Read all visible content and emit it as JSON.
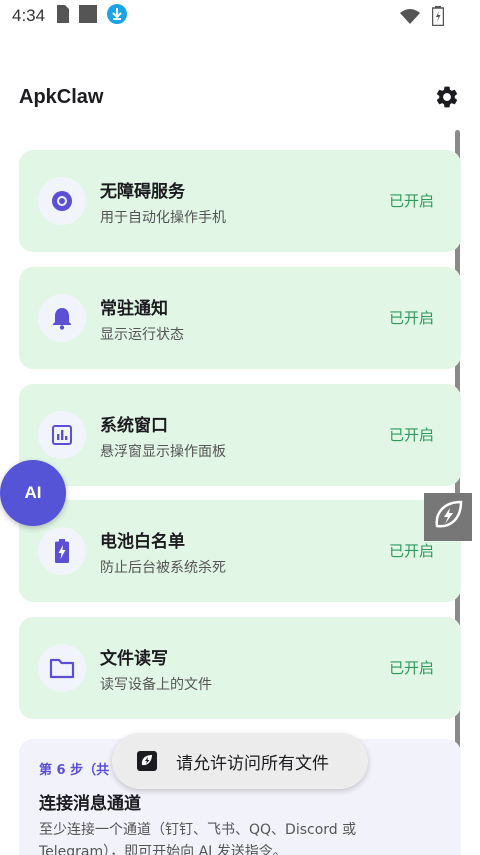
{
  "status_bar": {
    "time": "4:34",
    "icons": [
      "sim-card-icon",
      "square-icon",
      "download-icon",
      "wifi-icon",
      "battery-icon"
    ]
  },
  "app": {
    "title": "ApkClaw",
    "settings_icon": "gear-icon"
  },
  "permissions": [
    {
      "title": "无障碍服务",
      "subtitle": "用于自动化操作手机",
      "status": "已开启",
      "icon": "accessibility-icon"
    },
    {
      "title": "常驻通知",
      "subtitle": "显示运行状态",
      "status": "已开启",
      "icon": "bell-icon"
    },
    {
      "title": "系统窗口",
      "subtitle": "悬浮窗显示操作面板",
      "status": "已开启",
      "icon": "chart-window-icon"
    },
    {
      "title": "电池白名单",
      "subtitle": "防止后台被系统杀死",
      "status": "已开启",
      "icon": "battery-charging-icon"
    },
    {
      "title": "文件读写",
      "subtitle": "读写设备上的文件",
      "status": "已开启",
      "icon": "folder-icon"
    }
  ],
  "step": {
    "label": "第 6 步（共",
    "title": "连接消息通道",
    "description": "至少连接一个通道（钉钉、飞书、QQ、Discord 或 Telegram），即可开始向 AI 发送指令。"
  },
  "ai_bubble": {
    "label": "AI"
  },
  "toast": {
    "text": "请允许访问所有文件"
  },
  "colors": {
    "card_bg": "#e1f6e5",
    "status_green": "#2f9a5c",
    "accent_purple": "#5654d6",
    "icon_purple": "#5b4fd6"
  }
}
